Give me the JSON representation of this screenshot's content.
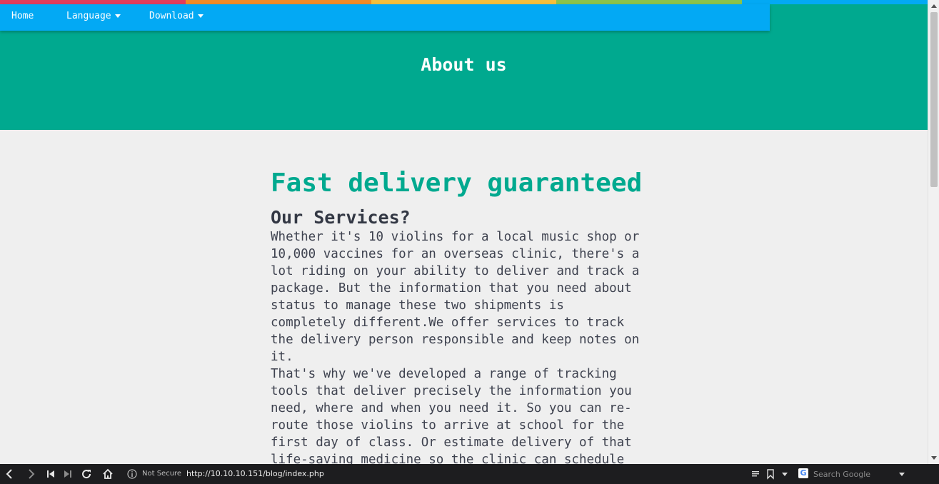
{
  "colors": {
    "rainbow": [
      "#e23d5b",
      "#f28b26",
      "#f5bf3b",
      "#8bc34a",
      "#03a9f4"
    ],
    "navbar": "#03a9f4",
    "banner": "#00a98f",
    "headline": "#00a98f"
  },
  "nav": {
    "home": "Home",
    "language": "Language",
    "download": "Download"
  },
  "banner": {
    "title": "About us"
  },
  "content": {
    "headline": "Fast delivery guaranteed",
    "subhead": "Our Services?",
    "paragraph1": "Whether it's 10 violins for a local music shop or 10,000 vaccines for an overseas clinic, there's a lot riding on your ability to deliver and track a package. But the information that you need about status to manage these two shipments is completely different.We offer services to track the delivery person responsible and keep notes on it.",
    "paragraph2": "That's why we've developed a range of tracking tools that deliver precisely the information you need, where and when you need it. So you can re-route those violins to arrive at school for the first day of class. Or estimate delivery of that life-saving medicine so the clinic can schedule staff."
  },
  "browser": {
    "security_label": "Not Secure",
    "url": "http://10.10.10.151/blog/index.php",
    "search_placeholder": "Search Google",
    "icons": [
      "back-icon",
      "forward-icon",
      "rewind-icon",
      "fast-forward-icon",
      "reload-icon",
      "home-icon",
      "info-icon",
      "reader-icon",
      "bookmark-icon",
      "dropdown-icon",
      "google-icon"
    ]
  }
}
